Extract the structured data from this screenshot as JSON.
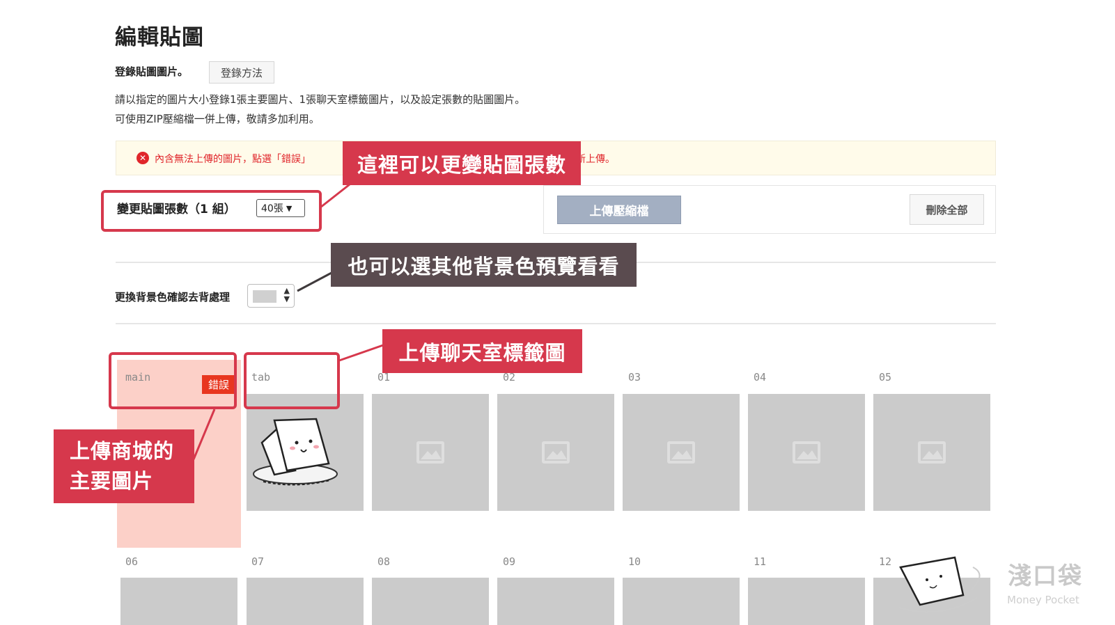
{
  "page": {
    "title": "編輯貼圖",
    "register_label": "登錄貼圖圖片。",
    "howto_button": "登錄方法",
    "desc_line1": "請以指定的圖片大小登錄1張主要圖片、1張聊天室標籤圖片，以及設定張數的貼圖圖片。",
    "desc_line2": "可使用ZIP壓縮檔一併上傳，敬請多加利用。"
  },
  "error": {
    "icon": "x-circle-icon",
    "text_left": "內含無法上傳的圖片，點選「錯誤」",
    "text_right": "新上傳。"
  },
  "count": {
    "label": "變更貼圖張數（1 組）",
    "value": "40張"
  },
  "upload": {
    "zip_button": "上傳壓縮檔",
    "delete_all_button": "刪除全部"
  },
  "background": {
    "label": "更換背景色確認去背處理",
    "swatch_color": "#d0d0d0"
  },
  "grid": {
    "main_label": "main",
    "error_badge": "錯誤",
    "tab_label": "tab",
    "row1": [
      "01",
      "02",
      "03",
      "04",
      "05"
    ],
    "row2": [
      "06",
      "07",
      "08",
      "09",
      "10",
      "11",
      "12"
    ]
  },
  "callouts": {
    "count": "這裡可以更變貼圖張數",
    "bg": "也可以選其他背景色預覽看看",
    "tab": "上傳聊天室標籤圖",
    "main_line1": "上傳商城的",
    "main_line2": "主要圖片"
  },
  "watermark": {
    "name": "淺口袋",
    "sub": "Money Pocket"
  },
  "colors": {
    "annotation_red": "#d6384c",
    "annotation_dark": "#5a4b4f",
    "error_red": "#e0262b",
    "main_cell_bg": "#fcd0c8",
    "placeholder": "#cbcbcb"
  }
}
